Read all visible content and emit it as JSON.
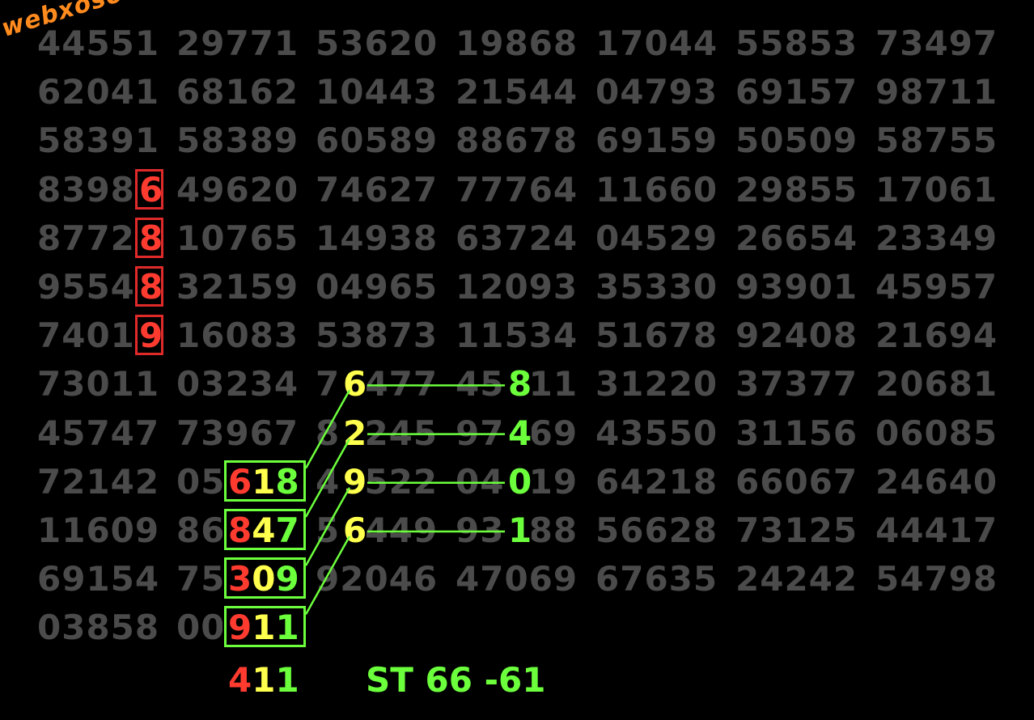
{
  "watermark": "webxoso.net",
  "rows": [
    [
      "44551",
      "29771",
      "53620",
      "19868",
      "17044",
      "55853",
      "73497"
    ],
    [
      "62041",
      "68162",
      "10443",
      "21544",
      "04793",
      "69157",
      "98711"
    ],
    [
      "58391",
      "58389",
      "60589",
      "88678",
      "69159",
      "50509",
      "58755"
    ],
    [
      "83986",
      "49620",
      "74627",
      "77764",
      "11660",
      "29855",
      "17061"
    ],
    [
      "87728",
      "10765",
      "14938",
      "63724",
      "04529",
      "26654",
      "23349"
    ],
    [
      "95548",
      "32159",
      "04965",
      "12093",
      "35330",
      "93901",
      "45957"
    ],
    [
      "74019",
      "16083",
      "53873",
      "11534",
      "51678",
      "92408",
      "21694"
    ],
    [
      "73011",
      "03234",
      "76477",
      "45811",
      "31220",
      "37377",
      "20681"
    ],
    [
      "45747",
      "73967",
      "82245",
      "97469",
      "43550",
      "31156",
      "06085"
    ],
    [
      "72142",
      "05618",
      "48522",
      "04019",
      "64218",
      "66067",
      "24640"
    ],
    [
      "11609",
      "86847",
      "56449",
      "93188",
      "56628",
      "73125",
      "44417"
    ],
    [
      "69154",
      "75309",
      "92046",
      "47069",
      "67635",
      "24242",
      "54798"
    ],
    [
      "03858",
      "00911"
    ]
  ],
  "red_digits": [
    "6",
    "8",
    "8",
    "9"
  ],
  "boxed_groups": [
    {
      "d1": "6",
      "d2": "1",
      "d3": "8"
    },
    {
      "d1": "8",
      "d2": "4",
      "d3": "7"
    },
    {
      "d1": "3",
      "d2": "0",
      "d3": "9"
    },
    {
      "d1": "9",
      "d2": "1",
      "d3": "1"
    }
  ],
  "pairs": [
    {
      "left": "6",
      "right": "8"
    },
    {
      "left": "2",
      "right": "4"
    },
    {
      "left": "9",
      "right": "0"
    },
    {
      "left": "6",
      "right": "1"
    }
  ],
  "footer": {
    "left": {
      "d1": "4",
      "d2": "1",
      "d3": "1"
    },
    "right": "ST 66 -61"
  },
  "colors": {
    "background": "#000000",
    "grid_text": "#4b4b4b",
    "red": "#ff3b30",
    "yellow": "#ffff4d",
    "green": "#6cff3c",
    "watermark": "#ff8a1e"
  }
}
